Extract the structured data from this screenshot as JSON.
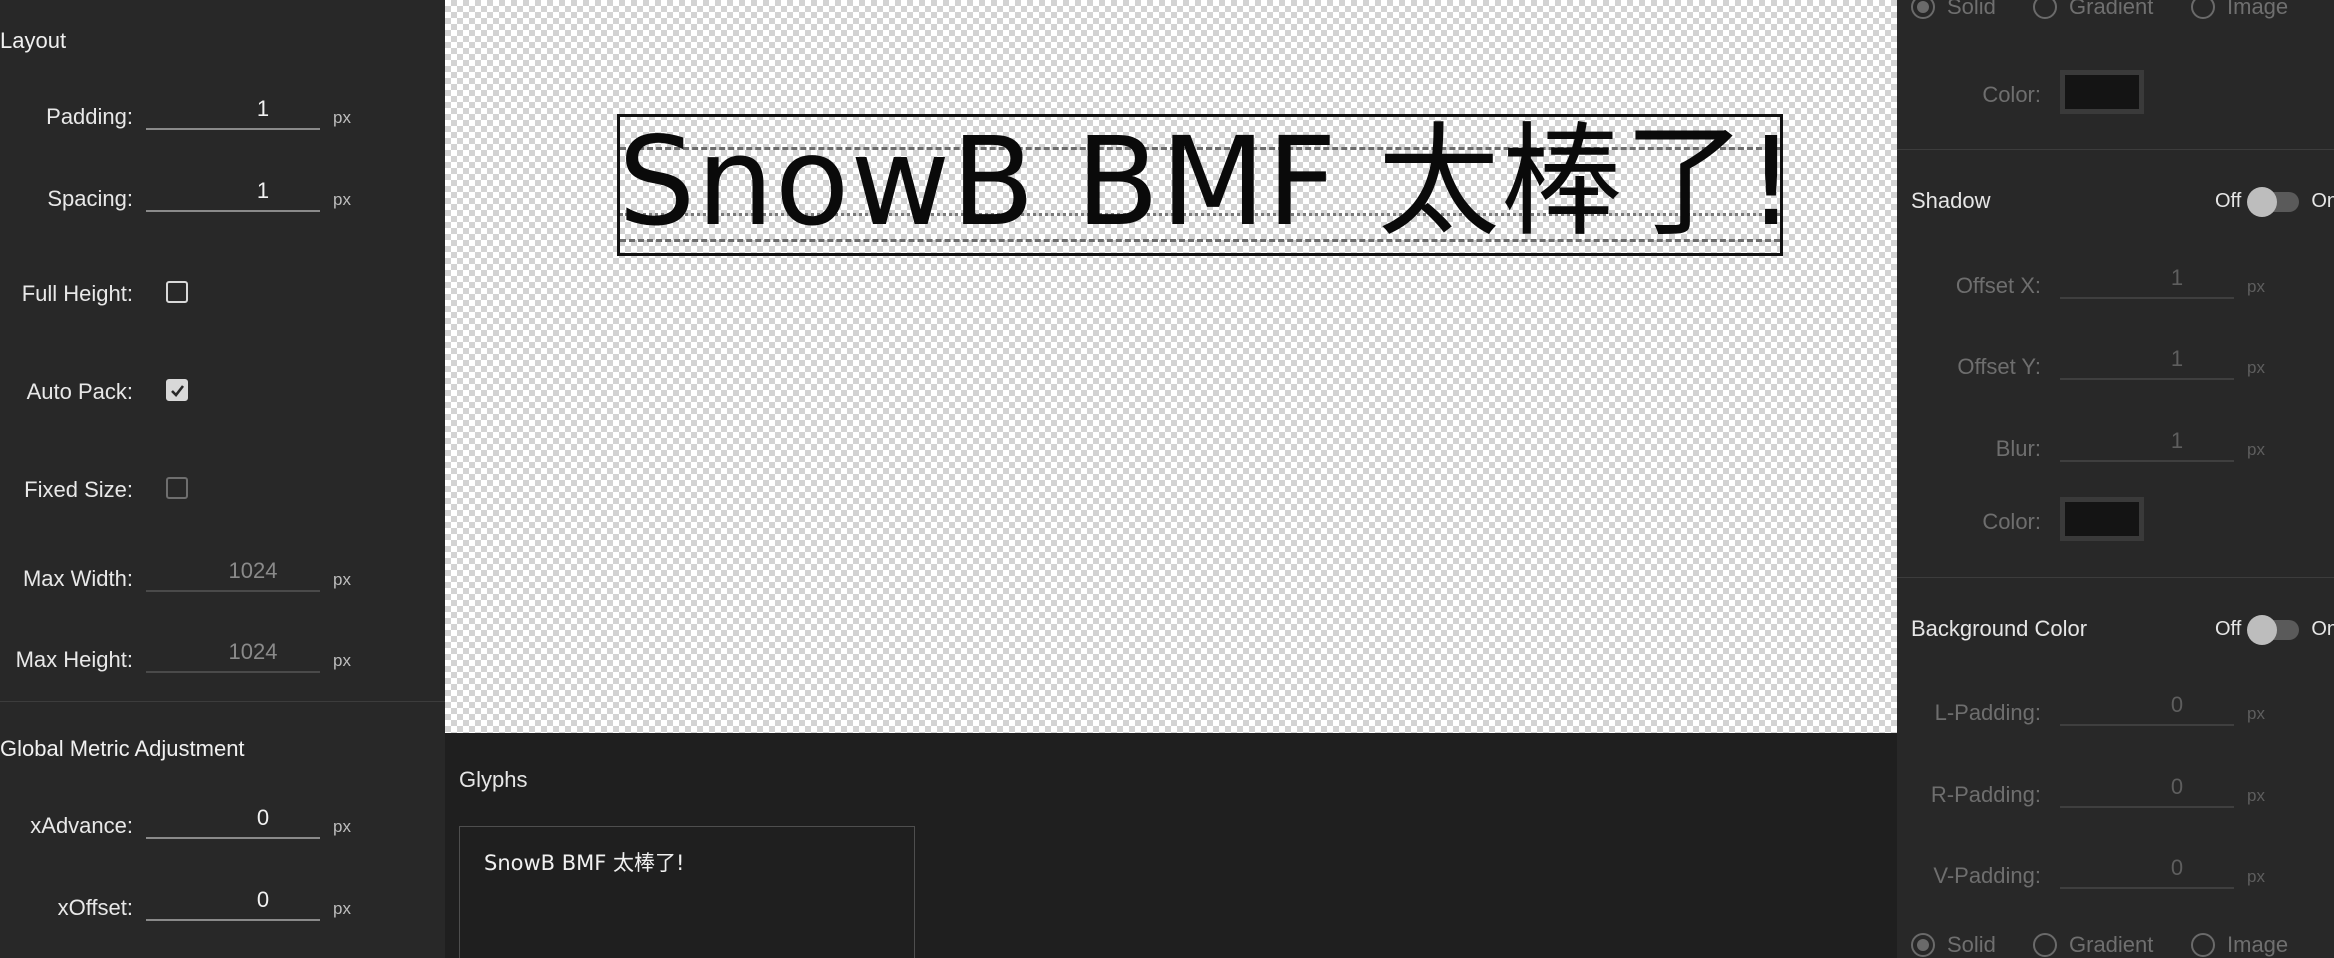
{
  "left": {
    "layout_title": "Layout",
    "padding": {
      "label": "Padding:",
      "value": "1",
      "unit": "px"
    },
    "spacing": {
      "label": "Spacing:",
      "value": "1",
      "unit": "px"
    },
    "full_height": {
      "label": "Full Height:",
      "checked": false
    },
    "auto_pack": {
      "label": "Auto Pack:",
      "checked": true
    },
    "fixed_size": {
      "label": "Fixed Size:",
      "checked": false
    },
    "max_width": {
      "label": "Max Width:",
      "value": "1024",
      "unit": "px"
    },
    "max_height": {
      "label": "Max Height:",
      "value": "1024",
      "unit": "px"
    },
    "metric_title": "Global Metric Adjustment",
    "x_advance": {
      "label": "xAdvance:",
      "value": "0",
      "unit": "px"
    },
    "x_offset": {
      "label": "xOffset:",
      "value": "0",
      "unit": "px"
    }
  },
  "preview": {
    "atlas_text": "SnowB BMF 太棒了!"
  },
  "glyphs": {
    "title": "Glyphs",
    "text": "SnowB BMF 太棒了!"
  },
  "right": {
    "fill_type_top": {
      "solid": "Solid",
      "gradient": "Gradient",
      "image": "Image",
      "selected": "Solid"
    },
    "fill_color_label": "Color:",
    "shadow": {
      "title": "Shadow",
      "toggle_off": "Off",
      "toggle_on": "On",
      "offset_x": {
        "label": "Offset X:",
        "value": "1",
        "unit": "px"
      },
      "offset_y": {
        "label": "Offset Y:",
        "value": "1",
        "unit": "px"
      },
      "blur": {
        "label": "Blur:",
        "value": "1",
        "unit": "px"
      },
      "color_label": "Color:"
    },
    "background": {
      "title": "Background Color",
      "toggle_off": "Off",
      "toggle_on": "On",
      "l_padding": {
        "label": "L-Padding:",
        "value": "0",
        "unit": "px"
      },
      "r_padding": {
        "label": "R-Padding:",
        "value": "0",
        "unit": "px"
      },
      "v_padding": {
        "label": "V-Padding:",
        "value": "0",
        "unit": "px"
      }
    },
    "fill_type_bottom": {
      "solid": "Solid",
      "gradient": "Gradient",
      "image": "Image",
      "selected": "Solid"
    }
  },
  "colors": {
    "panel_bg": "#282828",
    "app_bg": "#1f1f1f",
    "swatch": "#141414"
  }
}
